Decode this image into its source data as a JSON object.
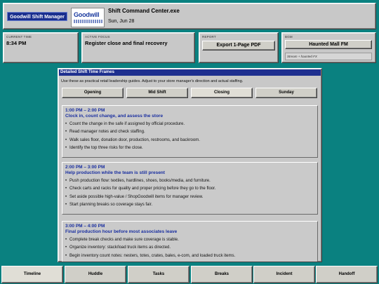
{
  "header": {
    "brand_badge": "Goodwill Shift Manager",
    "logo_text": "Goodwill",
    "title": "Shift Command Center.exe",
    "date": "Sun, Jun 28"
  },
  "cards": {
    "time": {
      "label": "CURRENT TIME",
      "value": "8:34 PM"
    },
    "focus": {
      "label": "ACTIVE FOCUS",
      "value": "Register close and final recovery"
    },
    "report": {
      "label": "REPORT",
      "button": "Export 1-Page PDF"
    },
    "bgm": {
      "label": "BGM",
      "button": "Haunted Mall FM",
      "sub": "Stream + haunted FX"
    }
  },
  "main": {
    "title": "Detailed Shift Time Frames",
    "intro": "Use these as practical retail leadership guides. Adjust to your store manager's direction and actual staffing.",
    "tabs": [
      {
        "label": "Opening"
      },
      {
        "label": "Mid Shift"
      },
      {
        "label": "Closing"
      },
      {
        "label": "Sunday"
      }
    ],
    "active_tab": "Closing",
    "blocks": [
      {
        "time": "1:00 PM – 2:00 PM",
        "heading": "Clock in, count change, and assess the store",
        "items": [
          "Count the change in the safe if assigned by official procedure.",
          "Read manager notes and check staffing.",
          "Walk sales floor, donation door, production, restrooms, and backroom.",
          "Identify the top three risks for the close."
        ]
      },
      {
        "time": "2:00 PM – 3:00 PM",
        "heading": "Help production while the team is still present",
        "items": [
          "Push production flow: textiles, hardlines, shoes, books/media, and furniture.",
          "Check carts and racks for quality and proper pricing before they go to the floor.",
          "Set aside possible high-value / ShopGoodwill items for manager review.",
          "Start planning breaks so coverage stays fair."
        ]
      },
      {
        "time": "3:00 PM – 4:00 PM",
        "heading": "Final production hour before most associates leave",
        "items": [
          "Complete break checks and make sure coverage is stable.",
          "Organize inventory: stack/load truck items as directed.",
          "Begin inventory count notes: nesters, totes, crates, bales, e-com, and loaded truck items."
        ]
      }
    ]
  },
  "bottom_nav": [
    {
      "label": "Timeline"
    },
    {
      "label": "Huddle"
    },
    {
      "label": "Tasks"
    },
    {
      "label": "Breaks"
    },
    {
      "label": "Incident"
    },
    {
      "label": "Handoff"
    }
  ],
  "colors": {
    "desktop": "#0a8180",
    "titlebar": "#1e2f8f",
    "accent_text": "#1a2fa0",
    "panel": "#c8c8c8"
  }
}
